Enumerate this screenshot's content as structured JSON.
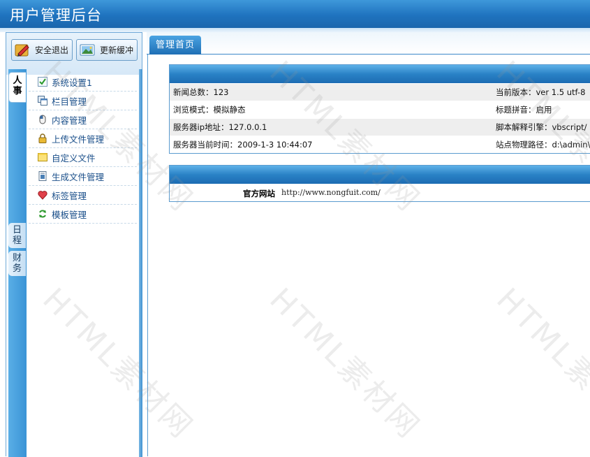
{
  "header": {
    "title": "用户管理后台"
  },
  "toolbar": {
    "logout_label": "安全退出",
    "refresh_label": "更新缓冲"
  },
  "sidebar": {
    "tabs": [
      {
        "label": "人事",
        "active": true
      },
      {
        "label": "日程",
        "active": false
      },
      {
        "label": "财务",
        "active": false
      }
    ],
    "items": [
      {
        "label": "系统设置1",
        "icon": "check-icon"
      },
      {
        "label": "栏目管理",
        "icon": "windows-icon"
      },
      {
        "label": "内容管理",
        "icon": "mouse-icon"
      },
      {
        "label": "上传文件管理",
        "icon": "lock-icon"
      },
      {
        "label": "自定义文件",
        "icon": "folder-icon"
      },
      {
        "label": "生成文件管理",
        "icon": "document-icon"
      },
      {
        "label": "标签管理",
        "icon": "heart-icon"
      },
      {
        "label": "模板管理",
        "icon": "refresh-icon"
      }
    ]
  },
  "main": {
    "tab_label": "管理首页",
    "info": [
      {
        "left": "新闻总数：123",
        "right": "当前版本：ver 1.5 utf-8"
      },
      {
        "left": "浏览模式：模拟静态",
        "right": "标题拼音：启用"
      },
      {
        "left": "服务器ip地址：127.0.0.1",
        "right": "脚本解释引擎：vbscript/"
      },
      {
        "left": "服务器当前时间：2009-1-3 10:44:07",
        "right": "站点物理路径：d:\\admin\\"
      }
    ],
    "site": {
      "label": "官方网站",
      "url": "http://www.nongfuit.com/"
    }
  },
  "watermark": "HTML素材网",
  "colors": {
    "header": "#1f73bf",
    "accent": "#3a94d6",
    "link": "#1a4f8a"
  }
}
